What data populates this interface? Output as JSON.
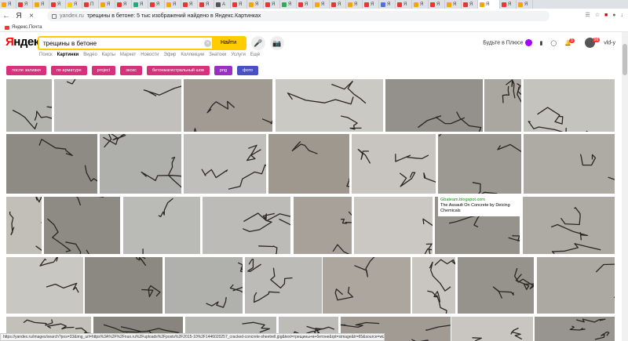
{
  "browser": {
    "tabs": [
      "Я",
      "Я",
      "Я",
      "Я",
      "Я",
      "П",
      "Я",
      "Я",
      "Я",
      "Я",
      "Я",
      "Я",
      "Я",
      "А",
      "Я",
      "Я",
      "Я",
      "Я",
      "Я",
      "Я",
      "Я",
      "Я",
      "Я",
      "Я",
      "Я",
      "Я",
      "Я",
      "Я",
      "Я",
      "Я",
      "Я",
      "Я"
    ],
    "active_tab": "Я",
    "url_domain": "yandex.ru",
    "page_title": "трещины в бетоне: 5 тыс изображений найдено в Яндекс.Картинках",
    "bookmark": "Яндекс.Почта"
  },
  "header": {
    "logo_first": "Я",
    "logo_rest": "ндекс",
    "search_value": "трещины в бетоне",
    "find_label": "Найти",
    "plus_label": "Будьте в Плюсе",
    "mail_badge": "3",
    "user_badge": "99",
    "user_name": "vld-y"
  },
  "services": [
    "Поиск",
    "Картинки",
    "Видео",
    "Карты",
    "Маркет",
    "Новости",
    "Эфир",
    "Коллекции",
    "Знатоки",
    "Услуги",
    "Ещё"
  ],
  "active_service": "Картинки",
  "chips": [
    {
      "label": "после заливки",
      "color": "#d6317a"
    },
    {
      "label": "по арматуре",
      "color": "#d6317a"
    },
    {
      "label": "project",
      "color": "#d6317a"
    },
    {
      "label": "эксис",
      "color": "#d6317a"
    },
    {
      "label": "бетонмагистральный шов",
      "color": "#d6317a"
    },
    {
      "label": "png",
      "color": "#9b2fc4"
    },
    {
      "label": "фото",
      "color": "#4a4fc2"
    }
  ],
  "tooltip": {
    "source": "Gbateam.blogspot.com",
    "title": "The Assault On Concrete by Deicing Chemicals"
  },
  "status_url": "https://yandex.ru/images/search?pos=33&img_url=https%3A%2F%2Fnuo.ru%2Fuploads%2Fposts%2F2015-10%2F1446020257_cracked-concrete-sheetrell.jpg&text=трещины+в+бетоне&rpt=simage&lr=65&source=wiz",
  "colors": {
    "search_border": "#ffcc00",
    "find_button": "#ffcc00",
    "accent_red": "#ff0000"
  }
}
